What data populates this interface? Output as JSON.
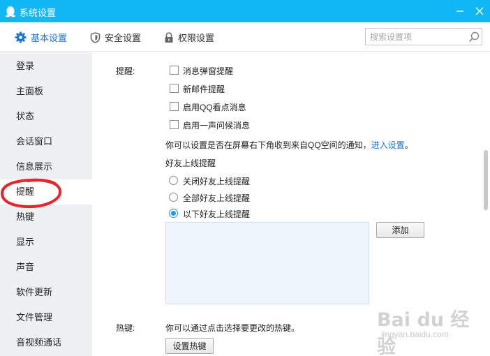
{
  "window": {
    "title": "系统设置"
  },
  "toolbar": {
    "tabs": [
      {
        "label": "基本设置",
        "icon": "gear-icon",
        "active": true
      },
      {
        "label": "安全设置",
        "icon": "shield-icon",
        "active": false
      },
      {
        "label": "权限设置",
        "icon": "lock-icon",
        "active": false
      }
    ],
    "search_placeholder": "搜索设置项"
  },
  "sidebar": {
    "items": [
      {
        "label": "登录"
      },
      {
        "label": "主面板"
      },
      {
        "label": "状态"
      },
      {
        "label": "会话窗口"
      },
      {
        "label": "信息展示"
      },
      {
        "label": "提醒",
        "active": true
      },
      {
        "label": "热键"
      },
      {
        "label": "显示"
      },
      {
        "label": "声音"
      },
      {
        "label": "软件更新"
      },
      {
        "label": "文件管理"
      },
      {
        "label": "音视频通话"
      }
    ]
  },
  "reminder": {
    "label": "提醒:",
    "checkboxes": [
      {
        "label": "消息弹窗提醒",
        "checked": false
      },
      {
        "label": "新邮件提醒",
        "checked": false
      },
      {
        "label": "启用QQ看点消息",
        "checked": false
      },
      {
        "label": "启用一声问候消息",
        "checked": false
      }
    ],
    "desc": "你可以设置是否在屏幕右下角收到来自QQ空间的通知，",
    "link": "进入设置",
    "desc_end": "。"
  },
  "friend_online": {
    "heading": "好友上线提醒",
    "options": [
      {
        "label": "关闭好友上线提醒",
        "checked": false
      },
      {
        "label": "全部好友上线提醒",
        "checked": false
      },
      {
        "label": "以下好友上线提醒",
        "checked": true
      }
    ],
    "add_button": "添加"
  },
  "hotkey": {
    "label": "热键:",
    "desc": "你可以通过点击选择要更改的热键。",
    "button": "设置热键"
  },
  "watermark": {
    "main": "Bai du 经验",
    "sub": "jingyan.baidu.com"
  },
  "colors": {
    "titlebar": "#12b7f5",
    "accent": "#1a73d9",
    "radio": "#1a9bef",
    "annotation": "#e8232a"
  }
}
